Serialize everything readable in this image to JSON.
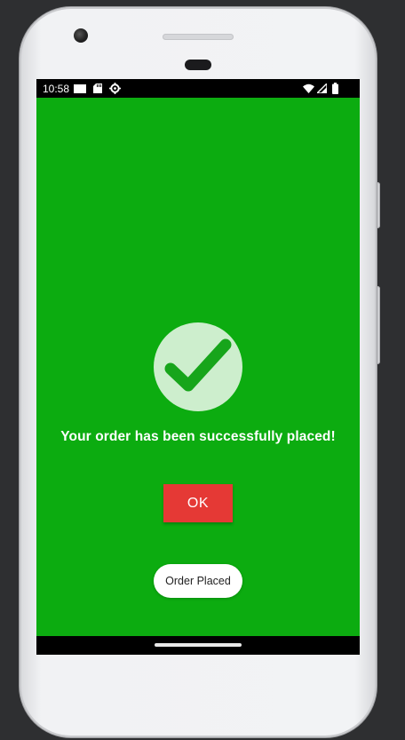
{
  "device": {
    "frame_color": "#f1f2f4",
    "background_color": "#2e2f31"
  },
  "status_bar": {
    "time": "10:58",
    "icons": [
      "card-icon",
      "sd-card-icon",
      "settings-gear-icon",
      "wifi-icon",
      "signal-icon",
      "battery-icon"
    ]
  },
  "screen": {
    "background_color": "#0cac10",
    "success_icon": "check-circle-icon",
    "message": "Your order has been successfully placed!",
    "ok_button_label": "OK",
    "ok_button_color": "#e53935",
    "toast_text": "Order Placed"
  },
  "navigation": {
    "home_indicator": "home-pill"
  }
}
